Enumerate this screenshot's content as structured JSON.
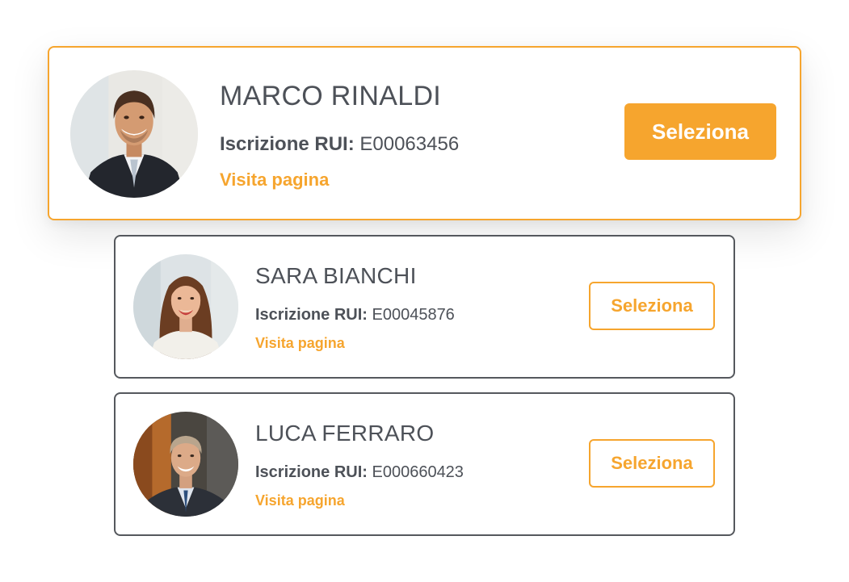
{
  "agents": [
    {
      "name": "MARCO RINALDI",
      "rui_label": "Iscrizione RUI:",
      "rui_value": "E00063456",
      "link_label": "Visita pagina",
      "button_label": "Seleziona",
      "selected": true
    },
    {
      "name": "SARA BIANCHI",
      "rui_label": "Iscrizione RUI:",
      "rui_value": "E00045876",
      "link_label": "Visita pagina",
      "button_label": "Seleziona",
      "selected": false
    },
    {
      "name": "LUCA FERRARO",
      "rui_label": "Iscrizione RUI:",
      "rui_value": "E000660423",
      "link_label": "Visita pagina",
      "button_label": "Seleziona",
      "selected": false
    }
  ],
  "colors": {
    "accent": "#f6a52e",
    "text": "#4d5158",
    "border": "#55585d"
  }
}
